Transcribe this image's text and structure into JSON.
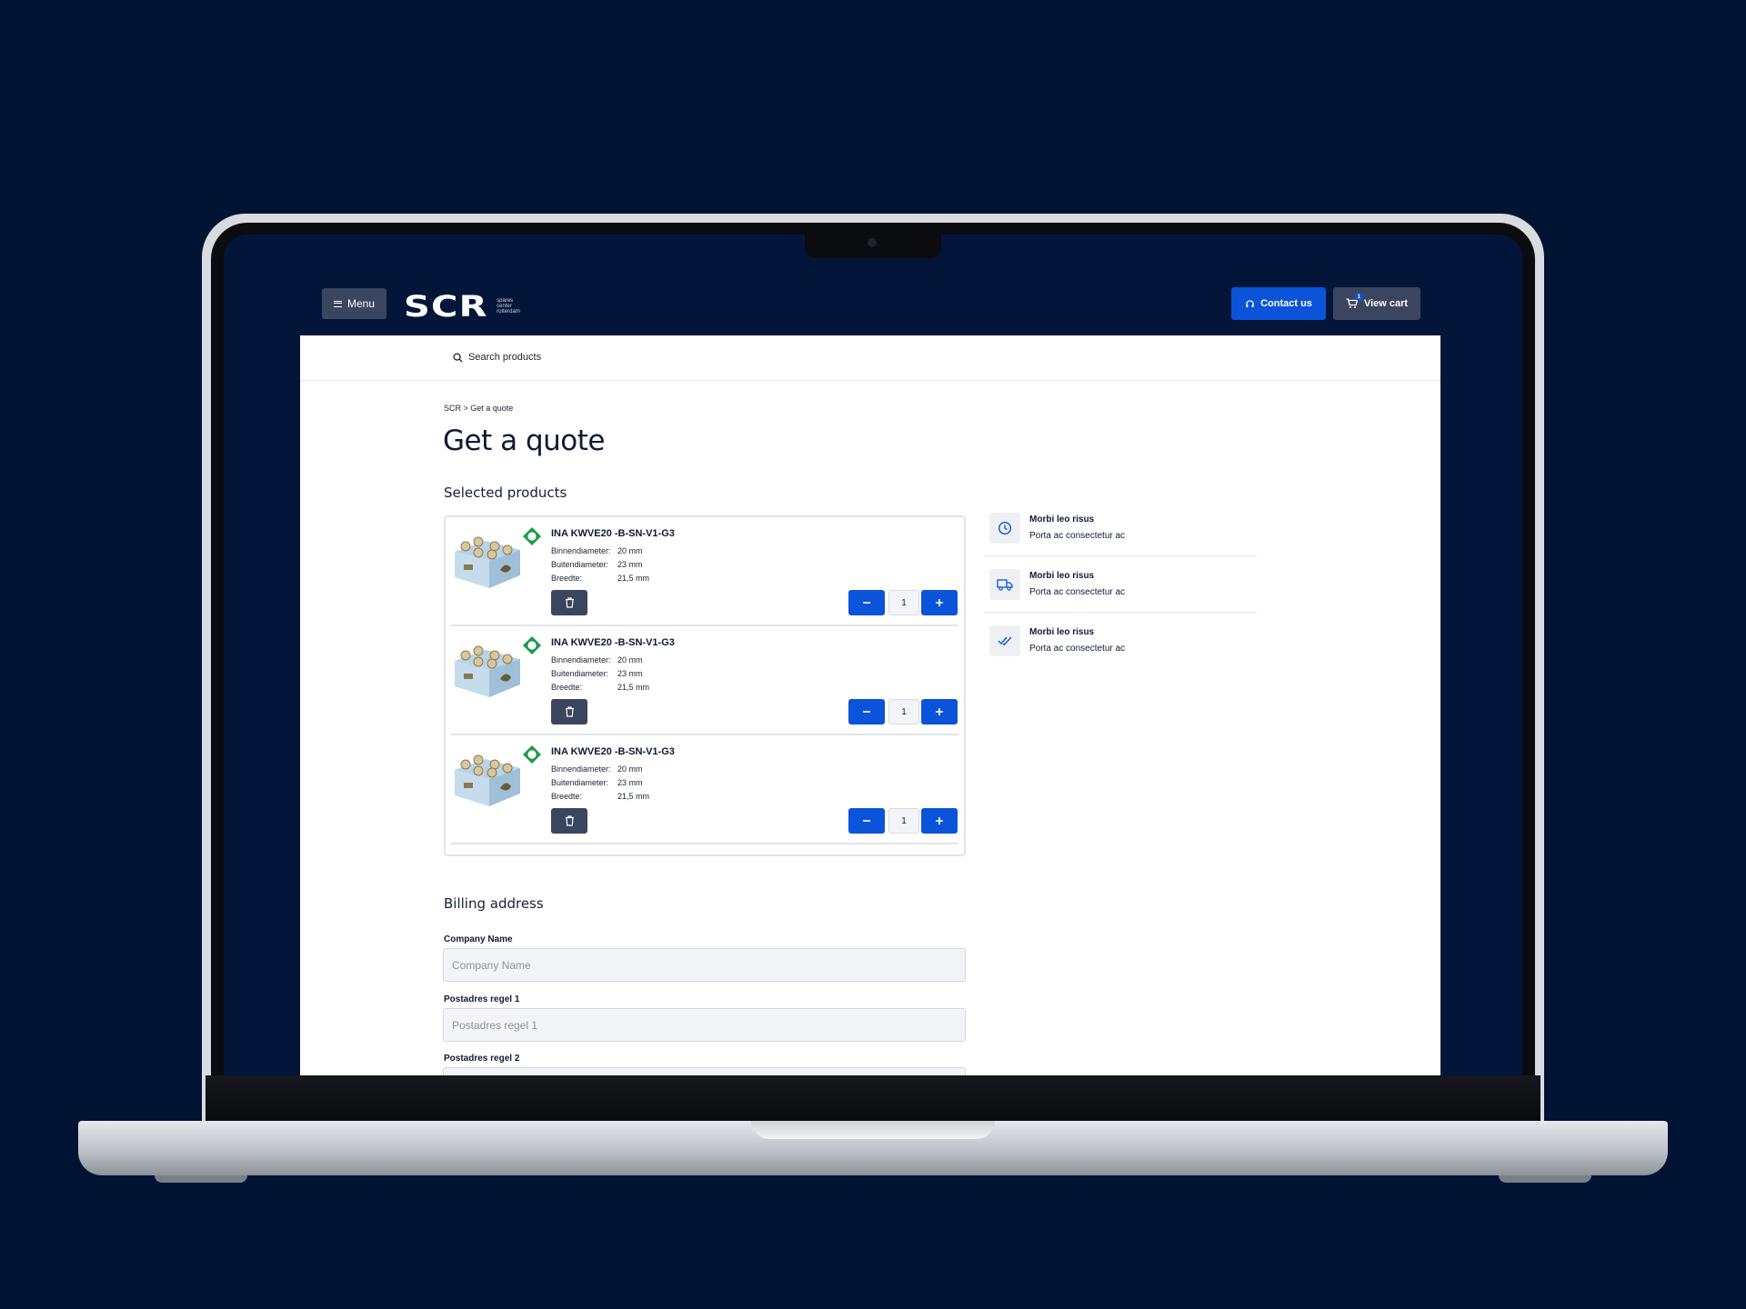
{
  "header": {
    "menu_label": "Menu",
    "logo_text": "SCR",
    "logo_sub": [
      "spares",
      "center",
      "rotterdam"
    ],
    "contact_label": "Contact us",
    "cart_label": "View cart",
    "cart_count": "1"
  },
  "search": {
    "placeholder": "Search products"
  },
  "breadcrumb": "SCR > Get a quote",
  "page_title": "Get a quote",
  "selected_products": {
    "heading": "Selected products",
    "items": [
      {
        "name": "INA KWVE20 -B-SN-V1-G3",
        "specs": [
          {
            "label": "Binnendiameter:",
            "value": "20 mm"
          },
          {
            "label": "Buitendiameter:",
            "value": "23 mm"
          },
          {
            "label": "Breedte:",
            "value": "21,5 mm"
          }
        ],
        "quantity": "1",
        "brand_badge": "INA"
      },
      {
        "name": "INA KWVE20 -B-SN-V1-G3",
        "specs": [
          {
            "label": "Binnendiameter:",
            "value": "20 mm"
          },
          {
            "label": "Buitendiameter:",
            "value": "23 mm"
          },
          {
            "label": "Breedte:",
            "value": "21,5 mm"
          }
        ],
        "quantity": "1",
        "brand_badge": "INA"
      },
      {
        "name": "INA KWVE20 -B-SN-V1-G3",
        "specs": [
          {
            "label": "Binnendiameter:",
            "value": "20 mm"
          },
          {
            "label": "Buitendiameter:",
            "value": "23 mm"
          },
          {
            "label": "Breedte:",
            "value": "21,5 mm"
          }
        ],
        "quantity": "1",
        "brand_badge": "INA"
      }
    ]
  },
  "features": [
    {
      "icon": "clock-icon",
      "title": "Morbi leo risus",
      "text": "Porta ac consectetur ac"
    },
    {
      "icon": "truck-icon",
      "title": "Morbi leo risus",
      "text": "Porta ac consectetur ac"
    },
    {
      "icon": "double-check-icon",
      "title": "Morbi leo risus",
      "text": "Porta ac consectetur ac"
    }
  ],
  "billing": {
    "heading": "Billing address",
    "fields": [
      {
        "label": "Company Name",
        "placeholder": "Company Name"
      },
      {
        "label": "Postadres regel 1",
        "placeholder": "Postadres regel 1"
      },
      {
        "label": "Postadres regel 2",
        "placeholder": ""
      }
    ]
  },
  "colors": {
    "background": "#021433",
    "accent": "#0b54d9",
    "dark_button": "#3a4560",
    "badge_green": "#1f9a4d"
  }
}
